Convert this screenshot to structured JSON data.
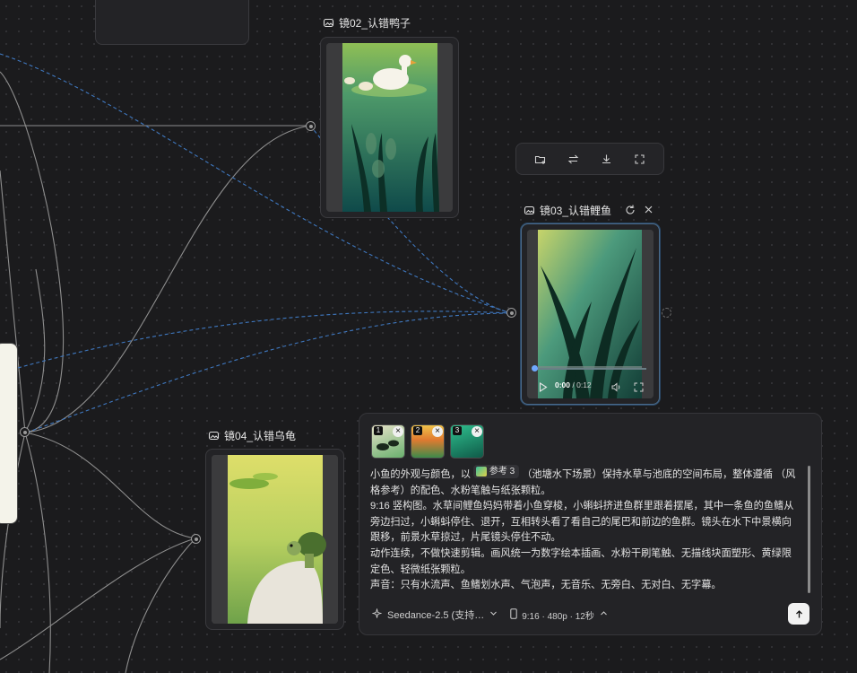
{
  "nodes": {
    "duck": {
      "title": "镜02_认错鸭子"
    },
    "carp": {
      "title": "镜03_认错鲤鱼"
    },
    "turtle": {
      "title": "镜04_认错乌龟"
    }
  },
  "toolbar": {
    "icons": [
      "add-to-folder-icon",
      "swap-icon",
      "download-icon",
      "fullscreen-icon"
    ]
  },
  "video": {
    "current_time": "0:00",
    "duration": "/ 0:12",
    "progress": 0
  },
  "prompt_panel": {
    "refs": [
      {
        "num": "1",
        "remove": "×"
      },
      {
        "num": "2",
        "remove": "×"
      },
      {
        "num": "3",
        "remove": "×"
      }
    ],
    "chip_label": "参考 3",
    "line1_a": "小鱼的外观与颜色，以",
    "line1_b": "（池塘水下场景）保持水草与池底的空间布局，整体遵循 （风格参考）的配色、水粉笔触与纸张颗粒。",
    "para2": "9:16 竖构图。水草间鲤鱼妈妈带着小鱼穿梭，小蝌蚪挤进鱼群里跟着摆尾，其中一条鱼的鱼鳍从旁边扫过，小蝌蚪停住、退开，互相转头看了看自己的尾巴和前边的鱼群。镜头在水下中景横向跟移，前景水草掠过，片尾镜头停住不动。",
    "para3": "动作连续，不做快速剪辑。画风统一为数字绘本插画、水粉干刷笔触、无描线块面塑形、黄绿限定色、轻微纸张颗粒。",
    "para4": "声音：只有水流声、鱼鳍划水声、气泡声，无音乐、无旁白、无对白、无字幕。",
    "model": "Seedance-2.5 (支持…",
    "settings": "9:16 · 480p · 12秒"
  },
  "colors": {
    "dashed_edge": "#3f78c0",
    "solid_edge": "#8e8e8e",
    "selected_border": "#4a6a8a"
  }
}
